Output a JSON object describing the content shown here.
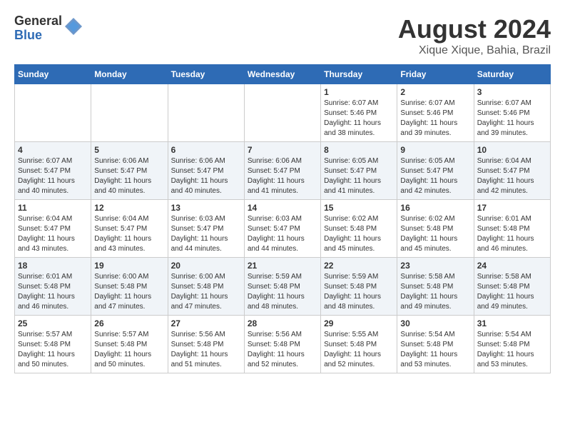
{
  "header": {
    "logo_general": "General",
    "logo_blue": "Blue",
    "title": "August 2024",
    "location": "Xique Xique, Bahia, Brazil"
  },
  "weekdays": [
    "Sunday",
    "Monday",
    "Tuesday",
    "Wednesday",
    "Thursday",
    "Friday",
    "Saturday"
  ],
  "weeks": [
    [
      {
        "day": "",
        "sunrise": "",
        "sunset": "",
        "daylight": ""
      },
      {
        "day": "",
        "sunrise": "",
        "sunset": "",
        "daylight": ""
      },
      {
        "day": "",
        "sunrise": "",
        "sunset": "",
        "daylight": ""
      },
      {
        "day": "",
        "sunrise": "",
        "sunset": "",
        "daylight": ""
      },
      {
        "day": "1",
        "sunrise": "Sunrise: 6:07 AM",
        "sunset": "Sunset: 5:46 PM",
        "daylight": "Daylight: 11 hours and 38 minutes."
      },
      {
        "day": "2",
        "sunrise": "Sunrise: 6:07 AM",
        "sunset": "Sunset: 5:46 PM",
        "daylight": "Daylight: 11 hours and 39 minutes."
      },
      {
        "day": "3",
        "sunrise": "Sunrise: 6:07 AM",
        "sunset": "Sunset: 5:46 PM",
        "daylight": "Daylight: 11 hours and 39 minutes."
      }
    ],
    [
      {
        "day": "4",
        "sunrise": "Sunrise: 6:07 AM",
        "sunset": "Sunset: 5:47 PM",
        "daylight": "Daylight: 11 hours and 40 minutes."
      },
      {
        "day": "5",
        "sunrise": "Sunrise: 6:06 AM",
        "sunset": "Sunset: 5:47 PM",
        "daylight": "Daylight: 11 hours and 40 minutes."
      },
      {
        "day": "6",
        "sunrise": "Sunrise: 6:06 AM",
        "sunset": "Sunset: 5:47 PM",
        "daylight": "Daylight: 11 hours and 40 minutes."
      },
      {
        "day": "7",
        "sunrise": "Sunrise: 6:06 AM",
        "sunset": "Sunset: 5:47 PM",
        "daylight": "Daylight: 11 hours and 41 minutes."
      },
      {
        "day": "8",
        "sunrise": "Sunrise: 6:05 AM",
        "sunset": "Sunset: 5:47 PM",
        "daylight": "Daylight: 11 hours and 41 minutes."
      },
      {
        "day": "9",
        "sunrise": "Sunrise: 6:05 AM",
        "sunset": "Sunset: 5:47 PM",
        "daylight": "Daylight: 11 hours and 42 minutes."
      },
      {
        "day": "10",
        "sunrise": "Sunrise: 6:04 AM",
        "sunset": "Sunset: 5:47 PM",
        "daylight": "Daylight: 11 hours and 42 minutes."
      }
    ],
    [
      {
        "day": "11",
        "sunrise": "Sunrise: 6:04 AM",
        "sunset": "Sunset: 5:47 PM",
        "daylight": "Daylight: 11 hours and 43 minutes."
      },
      {
        "day": "12",
        "sunrise": "Sunrise: 6:04 AM",
        "sunset": "Sunset: 5:47 PM",
        "daylight": "Daylight: 11 hours and 43 minutes."
      },
      {
        "day": "13",
        "sunrise": "Sunrise: 6:03 AM",
        "sunset": "Sunset: 5:47 PM",
        "daylight": "Daylight: 11 hours and 44 minutes."
      },
      {
        "day": "14",
        "sunrise": "Sunrise: 6:03 AM",
        "sunset": "Sunset: 5:47 PM",
        "daylight": "Daylight: 11 hours and 44 minutes."
      },
      {
        "day": "15",
        "sunrise": "Sunrise: 6:02 AM",
        "sunset": "Sunset: 5:48 PM",
        "daylight": "Daylight: 11 hours and 45 minutes."
      },
      {
        "day": "16",
        "sunrise": "Sunrise: 6:02 AM",
        "sunset": "Sunset: 5:48 PM",
        "daylight": "Daylight: 11 hours and 45 minutes."
      },
      {
        "day": "17",
        "sunrise": "Sunrise: 6:01 AM",
        "sunset": "Sunset: 5:48 PM",
        "daylight": "Daylight: 11 hours and 46 minutes."
      }
    ],
    [
      {
        "day": "18",
        "sunrise": "Sunrise: 6:01 AM",
        "sunset": "Sunset: 5:48 PM",
        "daylight": "Daylight: 11 hours and 46 minutes."
      },
      {
        "day": "19",
        "sunrise": "Sunrise: 6:00 AM",
        "sunset": "Sunset: 5:48 PM",
        "daylight": "Daylight: 11 hours and 47 minutes."
      },
      {
        "day": "20",
        "sunrise": "Sunrise: 6:00 AM",
        "sunset": "Sunset: 5:48 PM",
        "daylight": "Daylight: 11 hours and 47 minutes."
      },
      {
        "day": "21",
        "sunrise": "Sunrise: 5:59 AM",
        "sunset": "Sunset: 5:48 PM",
        "daylight": "Daylight: 11 hours and 48 minutes."
      },
      {
        "day": "22",
        "sunrise": "Sunrise: 5:59 AM",
        "sunset": "Sunset: 5:48 PM",
        "daylight": "Daylight: 11 hours and 48 minutes."
      },
      {
        "day": "23",
        "sunrise": "Sunrise: 5:58 AM",
        "sunset": "Sunset: 5:48 PM",
        "daylight": "Daylight: 11 hours and 49 minutes."
      },
      {
        "day": "24",
        "sunrise": "Sunrise: 5:58 AM",
        "sunset": "Sunset: 5:48 PM",
        "daylight": "Daylight: 11 hours and 49 minutes."
      }
    ],
    [
      {
        "day": "25",
        "sunrise": "Sunrise: 5:57 AM",
        "sunset": "Sunset: 5:48 PM",
        "daylight": "Daylight: 11 hours and 50 minutes."
      },
      {
        "day": "26",
        "sunrise": "Sunrise: 5:57 AM",
        "sunset": "Sunset: 5:48 PM",
        "daylight": "Daylight: 11 hours and 50 minutes."
      },
      {
        "day": "27",
        "sunrise": "Sunrise: 5:56 AM",
        "sunset": "Sunset: 5:48 PM",
        "daylight": "Daylight: 11 hours and 51 minutes."
      },
      {
        "day": "28",
        "sunrise": "Sunrise: 5:56 AM",
        "sunset": "Sunset: 5:48 PM",
        "daylight": "Daylight: 11 hours and 52 minutes."
      },
      {
        "day": "29",
        "sunrise": "Sunrise: 5:55 AM",
        "sunset": "Sunset: 5:48 PM",
        "daylight": "Daylight: 11 hours and 52 minutes."
      },
      {
        "day": "30",
        "sunrise": "Sunrise: 5:54 AM",
        "sunset": "Sunset: 5:48 PM",
        "daylight": "Daylight: 11 hours and 53 minutes."
      },
      {
        "day": "31",
        "sunrise": "Sunrise: 5:54 AM",
        "sunset": "Sunset: 5:48 PM",
        "daylight": "Daylight: 11 hours and 53 minutes."
      }
    ]
  ]
}
